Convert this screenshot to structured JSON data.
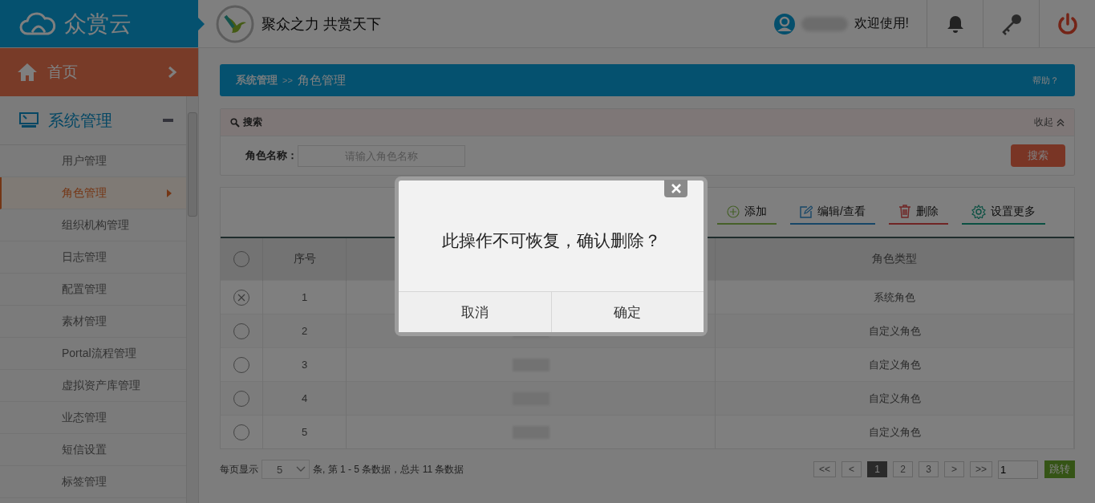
{
  "app": {
    "logo": "众赏云",
    "slogan": "聚众之力 共赏天下",
    "welcome": "欢迎使用!"
  },
  "sidebar": {
    "home": "首页",
    "section": {
      "label": "系统管理",
      "expanded": true
    },
    "items": [
      {
        "label": "用户管理",
        "selected": false
      },
      {
        "label": "角色管理",
        "selected": true
      },
      {
        "label": "组织机构管理",
        "selected": false
      },
      {
        "label": "日志管理",
        "selected": false
      },
      {
        "label": "配置管理",
        "selected": false
      },
      {
        "label": "素材管理",
        "selected": false
      },
      {
        "label": "Portal流程管理",
        "selected": false
      },
      {
        "label": "虚拟资产库管理",
        "selected": false
      },
      {
        "label": "业态管理",
        "selected": false
      },
      {
        "label": "短信设置",
        "selected": false
      },
      {
        "label": "标签管理",
        "selected": false
      }
    ]
  },
  "breadcrumb": {
    "parent": "系统管理",
    "separator": ">>",
    "current": "角色管理",
    "help": "帮助？"
  },
  "search": {
    "title": "搜索",
    "collapse": "收起",
    "field_label": "角色名称：",
    "placeholder": "请输入角色名称",
    "button": "搜索"
  },
  "toolbar": [
    {
      "kind": "add",
      "label": "添加"
    },
    {
      "kind": "edit",
      "label": "编辑/查看"
    },
    {
      "kind": "delete",
      "label": "删除"
    },
    {
      "kind": "settings",
      "label": "设置更多"
    }
  ],
  "table": {
    "all_selected": false,
    "columns": [
      {
        "kind": "index",
        "label": "序号"
      },
      {
        "kind": "name"
      },
      {
        "kind": "type",
        "label": "角色类型"
      }
    ],
    "rows": [
      {
        "index": "1",
        "type": "系统角色",
        "selected": true
      },
      {
        "index": "2",
        "type": "自定义角色",
        "selected": false
      },
      {
        "index": "3",
        "type": "自定义角色",
        "selected": false
      },
      {
        "index": "4",
        "type": "自定义角色",
        "selected": false
      },
      {
        "index": "5",
        "type": "自定义角色",
        "selected": false
      }
    ]
  },
  "pagination": {
    "per_page_label": "每页显示",
    "per_page": "5",
    "summary": "条, 第 1 - 5 条数据，总共 11 条数据",
    "buttons": [
      {
        "label": "<<",
        "selected": false
      },
      {
        "label": "<",
        "selected": false
      },
      {
        "label": "1",
        "selected": true
      },
      {
        "label": "2",
        "selected": false
      },
      {
        "label": "3",
        "selected": false
      },
      {
        "label": ">",
        "selected": false
      },
      {
        "label": ">>",
        "selected": false
      }
    ],
    "jump_value": "1",
    "jump_button": "跳转"
  },
  "dialog": {
    "message": "此操作不可恢复，确认删除？",
    "buttons": [
      "取消",
      "确定"
    ]
  }
}
